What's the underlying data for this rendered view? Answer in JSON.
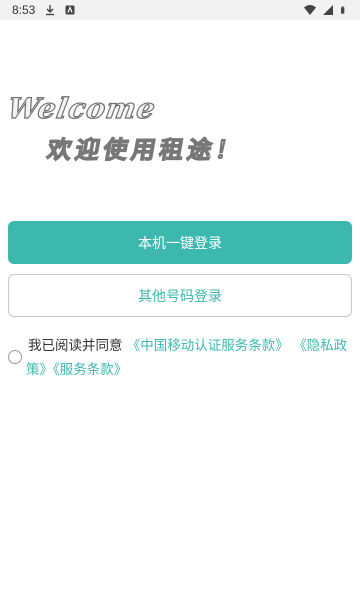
{
  "status_bar": {
    "time": "8:53",
    "left_icons": [
      "download-icon",
      "notification-app-icon"
    ],
    "right_icons": [
      "wifi-icon",
      "cellular-signal-icon",
      "battery-icon"
    ]
  },
  "welcome_title": "Welcome",
  "welcome_subtitle": "欢迎使用租途！",
  "buttons": {
    "one_click_login": "本机一键登录",
    "other_number_login": "其他号码登录"
  },
  "agreement": {
    "prefix": "我已阅读并同意",
    "links": [
      "《中国移动认证服务条款》",
      "《隐私政策》",
      "《服务条款》"
    ]
  },
  "colors": {
    "accent": "#3db8ae",
    "status_bar_bg": "#f2f2f2",
    "text": "#333333"
  }
}
